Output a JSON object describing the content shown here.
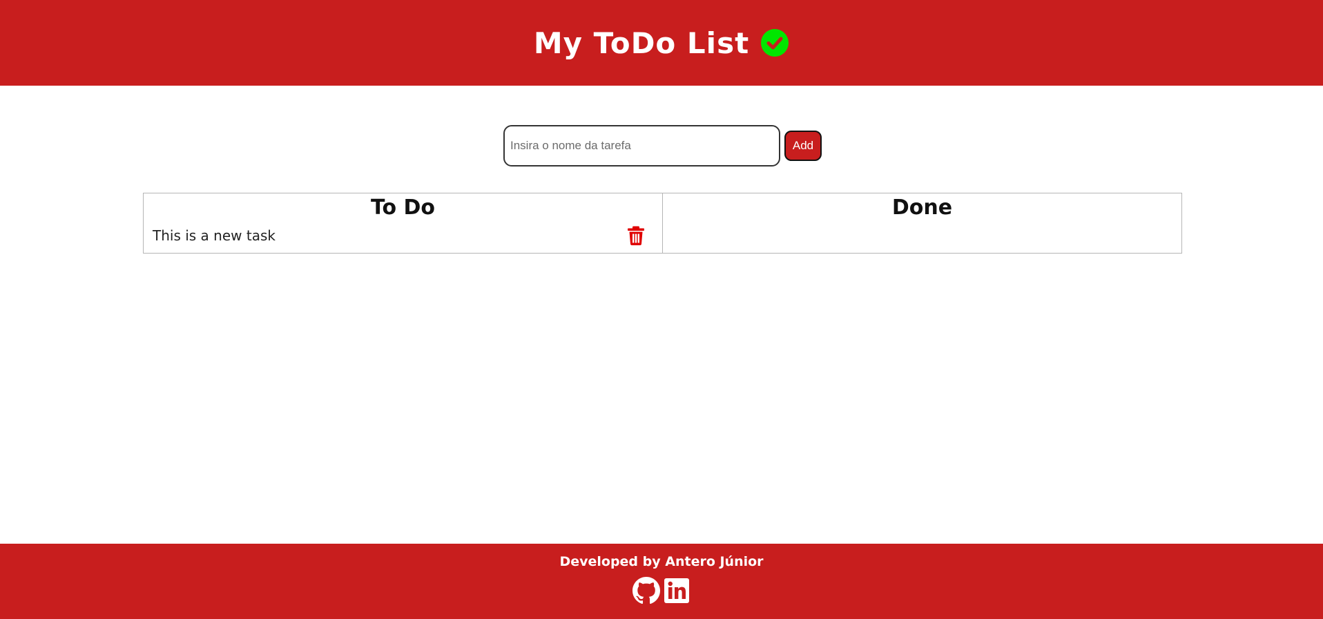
{
  "header": {
    "title": "My ToDo List",
    "title_icon": "check-circle-icon",
    "background_color": "#c81e1e",
    "icon_color": "#00e600"
  },
  "form": {
    "input_placeholder": "Insira o nome da tarefa",
    "input_value": "",
    "add_label": "Add"
  },
  "board": {
    "columns": [
      {
        "title": "To Do",
        "tasks": [
          {
            "text": "This is a new task",
            "action_icon": "trash-icon"
          }
        ]
      },
      {
        "title": "Done",
        "tasks": []
      }
    ],
    "accent_color": "#e00000"
  },
  "footer": {
    "text": "Developed by Antero Júnior",
    "links": [
      {
        "icon": "github-icon"
      },
      {
        "icon": "linkedin-icon"
      }
    ]
  }
}
